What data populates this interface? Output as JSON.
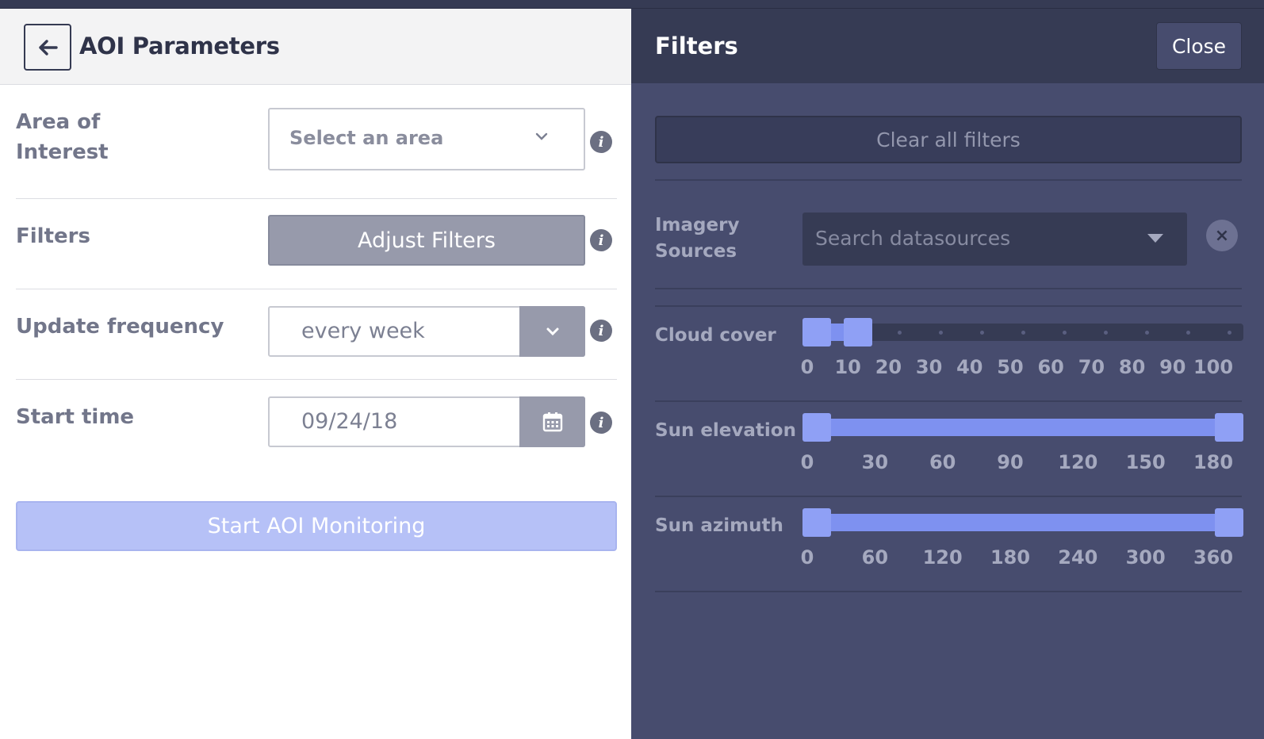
{
  "left": {
    "title": "AOI Parameters",
    "rows": {
      "area": {
        "label_line1": "Area of",
        "label_line2": "Interest",
        "placeholder": "Select an area"
      },
      "filters": {
        "label": "Filters",
        "button": "Adjust Filters"
      },
      "frequency": {
        "label": "Update frequency",
        "value": "every week"
      },
      "start": {
        "label": "Start time",
        "value": "09/24/18"
      }
    },
    "start_button": "Start AOI Monitoring",
    "info_glyph": "i"
  },
  "right": {
    "title": "Filters",
    "close": "Close",
    "clear_all": "Clear all filters",
    "imagery": {
      "label_line1": "Imagery",
      "label_line2": "Sources",
      "placeholder": "Search datasources",
      "clear_glyph": "×"
    },
    "sliders": [
      {
        "label": "Cloud cover",
        "min": 0,
        "max": 100,
        "low": 0,
        "high": 10,
        "ticks": [
          "0",
          "10",
          "20",
          "30",
          "40",
          "50",
          "60",
          "70",
          "80",
          "90",
          "100"
        ]
      },
      {
        "label": "Sun elevation",
        "min": 0,
        "max": 180,
        "low": 0,
        "high": 180,
        "ticks": [
          "0",
          "30",
          "60",
          "90",
          "120",
          "150",
          "180"
        ]
      },
      {
        "label": "Sun azimuth",
        "min": 0,
        "max": 360,
        "low": 0,
        "high": 360,
        "ticks": [
          "0",
          "60",
          "120",
          "180",
          "240",
          "300",
          "360"
        ]
      }
    ]
  },
  "colors": {
    "accent": "#7e91f0",
    "panel": "#474c6e",
    "header": "#363b54"
  }
}
